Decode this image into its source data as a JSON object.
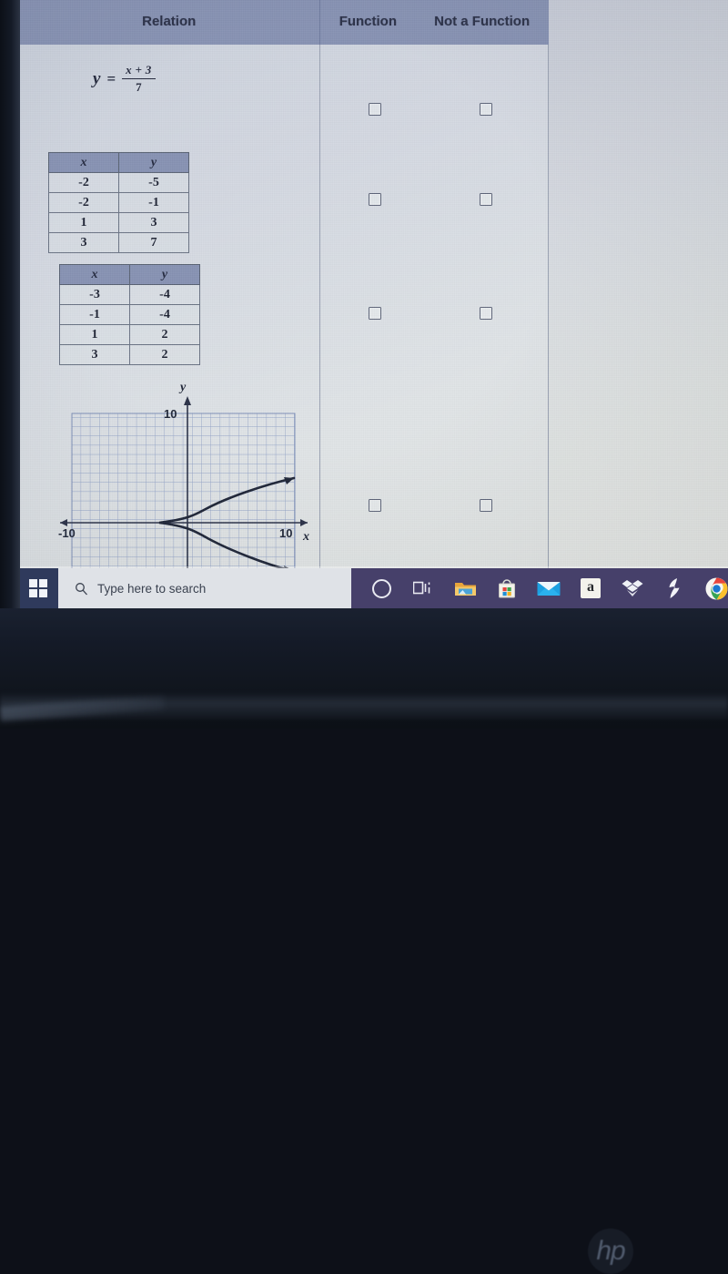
{
  "worksheet": {
    "headers": {
      "relation": "Relation",
      "function": "Function",
      "not_a_function": "Not a Function"
    },
    "header_bg": "#8792b3",
    "rows": [
      {
        "type": "equation",
        "equation": {
          "lhs": "y",
          "operator": "=",
          "numerator": "x + 3",
          "denominator": "7"
        }
      },
      {
        "type": "table",
        "columns": [
          "x",
          "y"
        ],
        "values": [
          [
            "-2",
            "-5"
          ],
          [
            "-2",
            "-1"
          ],
          [
            "1",
            "3"
          ],
          [
            "3",
            "7"
          ]
        ]
      },
      {
        "type": "table",
        "columns": [
          "x",
          "y"
        ],
        "values": [
          [
            "-3",
            "-4"
          ],
          [
            "-1",
            "-4"
          ],
          [
            "1",
            "2"
          ],
          [
            "3",
            "2"
          ]
        ]
      },
      {
        "type": "graph"
      }
    ]
  },
  "chart_data": {
    "type": "line",
    "title": "",
    "xlabel": "x",
    "ylabel": "y",
    "xlim": [
      -12,
      12
    ],
    "ylim": [
      -12,
      12
    ],
    "grid": true,
    "tick_labels": {
      "y_top": "10",
      "x_left": "-10",
      "x_right": "10"
    },
    "axis_arrows": true,
    "series": [
      {
        "name": "sideways parabola x = y^2 - 3",
        "note": "opens rightward, vertex at (-3, 0), arrowheads at both ends",
        "vertex": [
          -3,
          0
        ],
        "points": [
          [
            9,
            3.4
          ],
          [
            5,
            2.8
          ],
          [
            2,
            2.2
          ],
          [
            0,
            1.7
          ],
          [
            -1.5,
            1.2
          ],
          [
            -2.6,
            0.6
          ],
          [
            -3,
            0
          ],
          [
            -2.6,
            -0.6
          ],
          [
            -1.5,
            -1.2
          ],
          [
            0,
            -1.7
          ],
          [
            2,
            -2.3
          ],
          [
            5,
            -3.0
          ],
          [
            9,
            -3.6
          ]
        ],
        "color": "#1d2436"
      }
    ],
    "grid_color": "#8e9fc4",
    "axis_color": "#2a3147"
  },
  "checkboxes": {
    "rows": [
      {
        "relation": "equation",
        "function_checked": false,
        "not_a_function_checked": false
      },
      {
        "relation": "table-1",
        "function_checked": false,
        "not_a_function_checked": false
      },
      {
        "relation": "table-2",
        "function_checked": false,
        "not_a_function_checked": false
      },
      {
        "relation": "graph",
        "function_checked": false,
        "not_a_function_checked": false
      }
    ]
  },
  "taskbar": {
    "search_placeholder": "Type here to search",
    "background": "#46406a",
    "items": [
      {
        "name": "start-button",
        "icon": "windows-icon"
      },
      {
        "name": "search-box",
        "icon": "search-icon"
      },
      {
        "name": "cortana",
        "icon": "cortana-circle-icon"
      },
      {
        "name": "task-view",
        "icon": "task-view-icon"
      },
      {
        "name": "file-explorer",
        "icon": "folder-icon"
      },
      {
        "name": "microsoft-store",
        "icon": "store-bag-icon"
      },
      {
        "name": "mail",
        "icon": "envelope-icon"
      },
      {
        "name": "amazon",
        "icon": "amazon-a-icon",
        "label": "a"
      },
      {
        "name": "dropbox",
        "icon": "dropbox-icon"
      },
      {
        "name": "bolt-app",
        "icon": "lightning-bolt-icon",
        "label": "⚡"
      },
      {
        "name": "chrome",
        "icon": "chrome-icon"
      }
    ]
  },
  "device": {
    "brand": "hp"
  }
}
